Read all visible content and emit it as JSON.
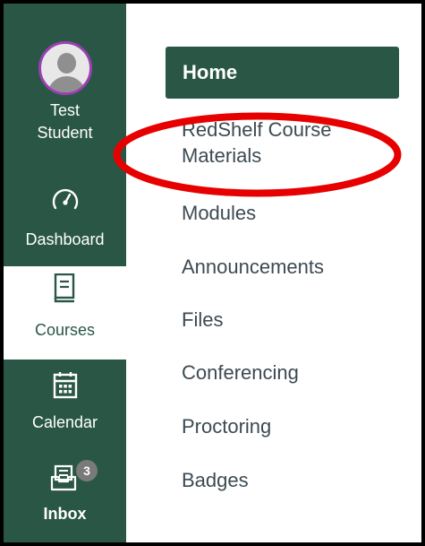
{
  "global_nav": {
    "account": {
      "label_line1": "Test",
      "label_line2": "Student"
    },
    "dashboard": {
      "label": "Dashboard",
      "icon": "dashboard-gauge-icon"
    },
    "courses": {
      "label": "Courses",
      "icon": "book-icon"
    },
    "calendar": {
      "label": "Calendar",
      "icon": "calendar-icon"
    },
    "inbox": {
      "label": "Inbox",
      "icon": "inbox-icon",
      "badge": "3"
    }
  },
  "course_nav": {
    "home": "Home",
    "redshelf_line1": "RedShelf Course",
    "redshelf_line2": "Materials",
    "modules": "Modules",
    "announcements": "Announcements",
    "files": "Files",
    "conferencing": "Conferencing",
    "proctoring": "Proctoring",
    "badges": "Badges"
  },
  "colors": {
    "nav_green": "#2a5745",
    "highlight_ellipse": "#e60000",
    "avatar_ring": "#9b3fb3"
  }
}
